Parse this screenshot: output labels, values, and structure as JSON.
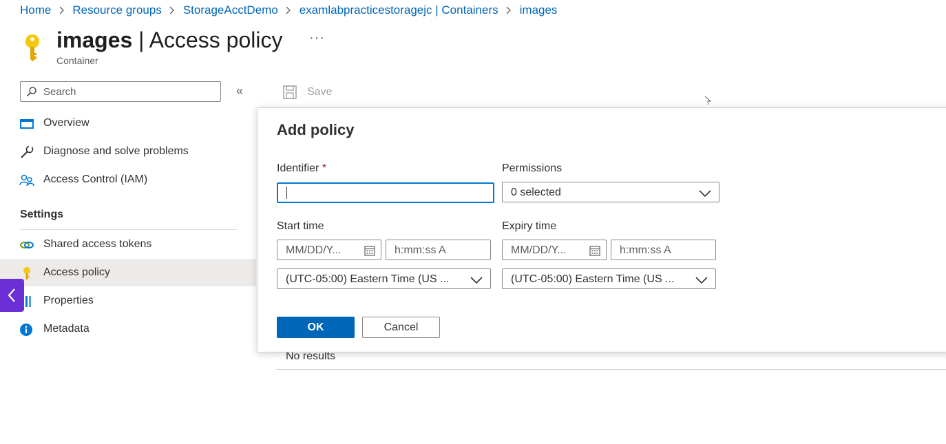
{
  "breadcrumb": [
    {
      "label": "Home"
    },
    {
      "label": "Resource groups"
    },
    {
      "label": "StorageAcctDemo"
    },
    {
      "label": "examlabpracticestoragejc | Containers"
    },
    {
      "label": "images"
    }
  ],
  "header": {
    "icon": "key-icon",
    "title_bold": "images",
    "title_rest": " | Access policy",
    "more": "···",
    "subtitle": "Container"
  },
  "sidebar": {
    "search_placeholder": "Search",
    "collapse_glyph": "«",
    "items": [
      {
        "label": "Overview",
        "icon": "overview-icon"
      },
      {
        "label": "Diagnose and solve problems",
        "icon": "wrench-icon"
      },
      {
        "label": "Access Control (IAM)",
        "icon": "people-icon"
      }
    ],
    "settings_header": "Settings",
    "settings_items": [
      {
        "label": "Shared access tokens",
        "icon": "link-icon"
      },
      {
        "label": "Access policy",
        "icon": "key-icon",
        "active": true
      },
      {
        "label": "Properties",
        "icon": "properties-icon"
      },
      {
        "label": "Metadata",
        "icon": "info-icon"
      }
    ]
  },
  "toolbar": {
    "save_label": "Save"
  },
  "content": {
    "no_results": "No results"
  },
  "dialog": {
    "title": "Add policy",
    "identifier_label": "Identifier",
    "required_mark": "*",
    "identifier_value": "",
    "permissions_label": "Permissions",
    "permissions_value": "0 selected",
    "start_label": "Start time",
    "start_date_placeholder": "MM/DD/Y...",
    "start_time_placeholder": "h:mm:ss A",
    "start_timezone": "(UTC-05:00) Eastern Time (US ...",
    "expiry_label": "Expiry time",
    "expiry_date_placeholder": "MM/DD/Y...",
    "expiry_time_placeholder": "h:mm:ss A",
    "expiry_timezone": "(UTC-05:00) Eastern Time (US ...",
    "ok_label": "OK",
    "cancel_label": "Cancel"
  },
  "colors": {
    "link": "#0066b8",
    "primary": "#0067b8",
    "focus": "#0078d4",
    "active_nav": "#edebe9",
    "side_tab": "#6b2fd6",
    "key_gold": "#f2c811"
  }
}
